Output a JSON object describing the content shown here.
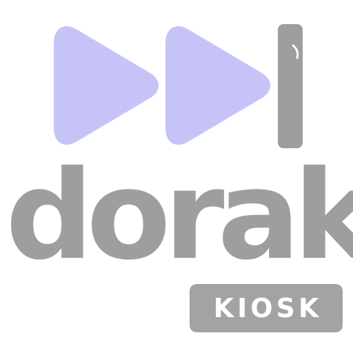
{
  "logo": {
    "wordmark": "dorak",
    "badge_label": "KIOSK",
    "icon": "fast-forward-icon"
  },
  "colors": {
    "play_triangles": "#c5c3f7",
    "wordmark": "#9e9e9e",
    "badge_background": "#a3a3a3",
    "badge_text": "#ffffff",
    "bar": "#9e9e9e"
  }
}
